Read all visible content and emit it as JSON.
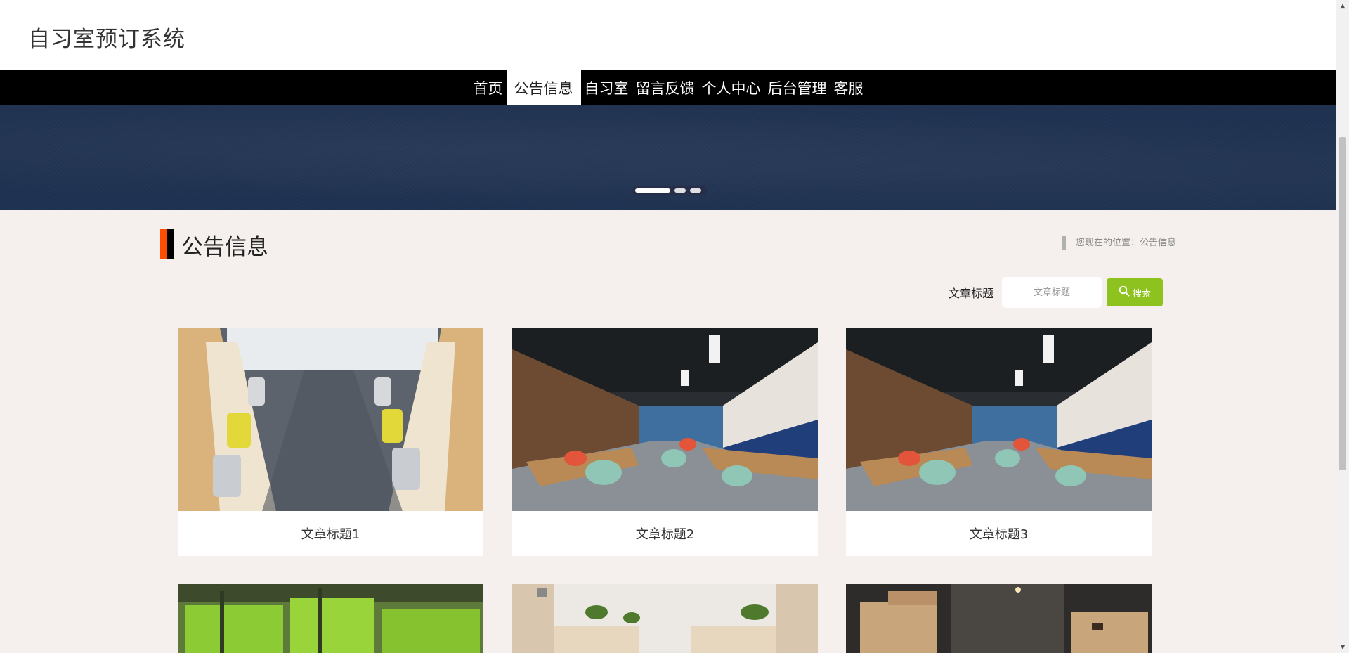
{
  "header": {
    "site_title": "自习室预订系统"
  },
  "nav": {
    "items": [
      {
        "label": "首页",
        "active": false
      },
      {
        "label": "公告信息",
        "active": true
      },
      {
        "label": "自习室",
        "active": false
      },
      {
        "label": "留言反馈",
        "active": false
      },
      {
        "label": "个人中心",
        "active": false
      },
      {
        "label": "后台管理",
        "active": false
      },
      {
        "label": "客服",
        "active": false
      }
    ]
  },
  "banner": {
    "slide_count": 3,
    "active_slide": 1
  },
  "section": {
    "title": "公告信息",
    "breadcrumb": "您现在的位置：公告信息",
    "title_bar_colors": [
      "#ff4d00",
      "#000000"
    ]
  },
  "search": {
    "label": "文章标题",
    "placeholder": "文章标题",
    "button_label": "搜索",
    "button_icon": "search-icon",
    "button_color": "#8dc21f"
  },
  "articles": [
    {
      "title": "文章标题1",
      "image": "study-room-white-chairs"
    },
    {
      "title": "文章标题2",
      "image": "library-cafe-teal-chairs"
    },
    {
      "title": "文章标题3",
      "image": "library-cafe-teal-chairs"
    },
    {
      "title": "",
      "image": "green-study-cubicles"
    },
    {
      "title": "",
      "image": "bright-study-room-plants"
    },
    {
      "title": "",
      "image": "dark-room-wooden-lockers"
    }
  ],
  "colors": {
    "nav_bg": "#000000",
    "page_bg": "#f5f0ed",
    "banner_bg": "#1e3150",
    "accent": "#ff4d00"
  }
}
